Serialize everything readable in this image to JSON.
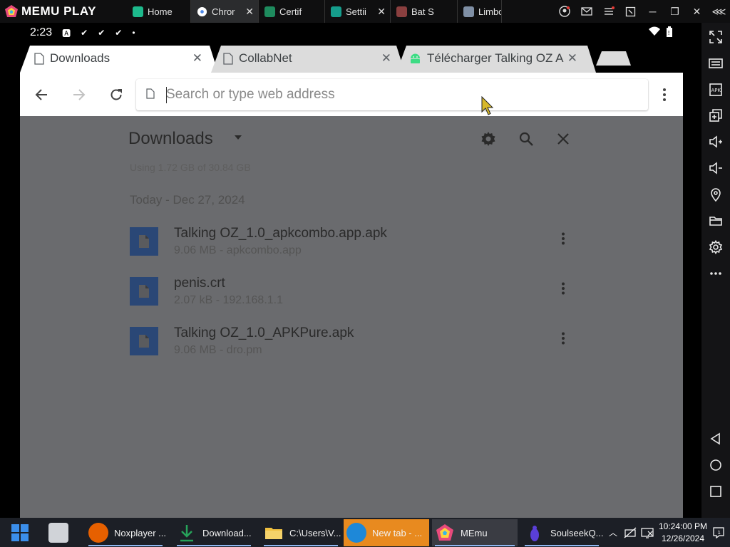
{
  "memu": {
    "brand": "MEMU PLAY",
    "tabs": [
      {
        "label": "Home",
        "active": false,
        "color": "#1db98c"
      },
      {
        "label": "Chror",
        "active": true,
        "color": "#ffffff"
      },
      {
        "label": "Certif",
        "active": false,
        "color": "#1e8b5e"
      },
      {
        "label": "Settii",
        "active": false,
        "color": "#159d8c"
      },
      {
        "label": "Bat S",
        "active": false,
        "color": "#8a3f3f"
      },
      {
        "label": "Limbo",
        "active": false,
        "color": "#7f8fa5"
      }
    ]
  },
  "status": {
    "time": "2:23"
  },
  "chrome": {
    "tabs": [
      {
        "label": "Downloads",
        "active": true
      },
      {
        "label": "CollabNet",
        "active": false
      },
      {
        "label": "Télécharger Talking OZ A",
        "active": false
      }
    ],
    "omnibox_placeholder": "Search or type web address"
  },
  "downloads": {
    "title": "Downloads",
    "storage": "Using 1.72 GB of 30.84 GB",
    "date_header": "Today - Dec 27, 2024",
    "items": [
      {
        "name": "Talking OZ_1.0_apkcombo.app.apk",
        "meta": "9.06 MB - apkcombo.app"
      },
      {
        "name": "penis.crt",
        "meta": "2.07 kB - 192.168.1.1"
      },
      {
        "name": "Talking OZ_1.0_APKPure.apk",
        "meta": "9.06 MB - dro.pm"
      }
    ]
  },
  "taskbar": {
    "items": [
      {
        "label": "Noxplayer ...",
        "color": "#e66000"
      },
      {
        "label": "Download...",
        "color": "#27a35a"
      },
      {
        "label": "C:\\Users\\V...",
        "color": "#f0c040"
      },
      {
        "label": "New tab - ...",
        "color": "#1e88d8"
      },
      {
        "label": "MEmu",
        "color": "#5a6ee0"
      },
      {
        "label": "SoulseekQ...",
        "color": "#5a3fd8"
      }
    ],
    "clock_time": "10:24:00 PM",
    "clock_date": "12/26/2024"
  }
}
